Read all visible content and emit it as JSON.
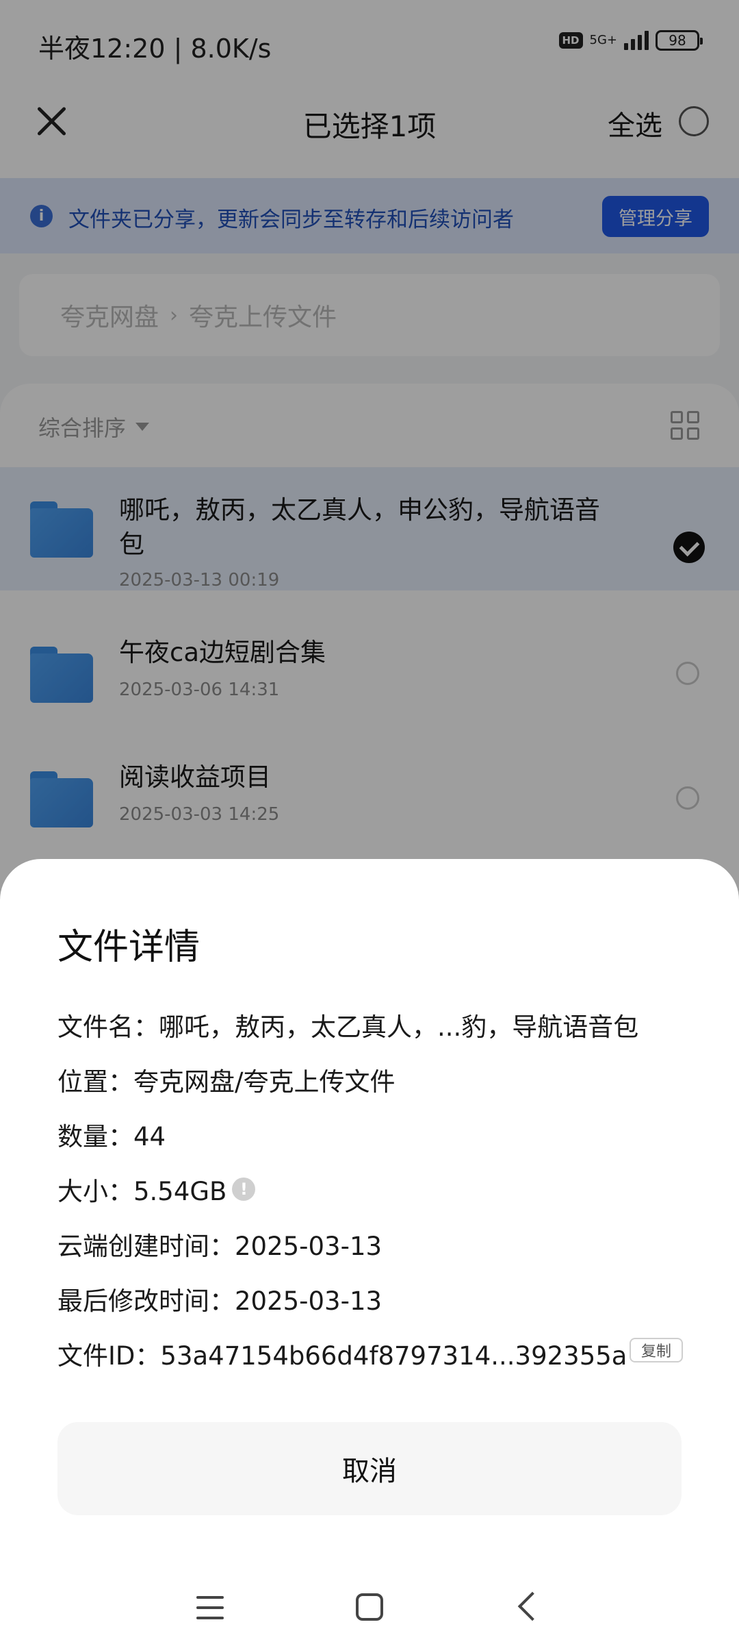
{
  "status_bar": {
    "time": "半夜12:20 | 8.0K/s",
    "hd": "HD",
    "network": "5G+",
    "battery": "98"
  },
  "top_bar": {
    "title": "已选择1项",
    "select_all_label": "全选"
  },
  "share_banner": {
    "text": "文件夹已分享，更新会同步至转存和后续访问者",
    "button_label": "管理分享"
  },
  "breadcrumb": {
    "root": "夸克网盘",
    "separator": "›",
    "current": "夸克上传文件"
  },
  "list": {
    "sort_label": "综合排序",
    "files": [
      {
        "name": "哪吒，敖丙，太乙真人，申公豹，导航语音包",
        "date": "2025-03-13 00:19",
        "selected": true
      },
      {
        "name": "午夜ca边短剧合集",
        "date": "2025-03-06 14:31",
        "selected": false
      },
      {
        "name": "阅读收益项目",
        "date": "2025-03-03 14:25",
        "selected": false
      }
    ]
  },
  "sheet": {
    "title": "文件详情",
    "details": {
      "filename": "文件名：哪吒，敖丙，太乙真人，...豹，导航语音包",
      "location": "位置：夸克网盘/夸克上传文件",
      "count": "数量：44",
      "size": "大小：5.54GB",
      "created": "云端创建时间：2025-03-13",
      "modified": "最后修改时间：2025-03-13",
      "file_id": "文件ID：53a47154b66d4f8797314...392355a"
    },
    "copy_label": "复制",
    "cancel_label": "取消"
  },
  "colors": {
    "accent": "#1f57e6",
    "banner_bg": "#dbe6fb",
    "folder": "#3a8ee6"
  }
}
